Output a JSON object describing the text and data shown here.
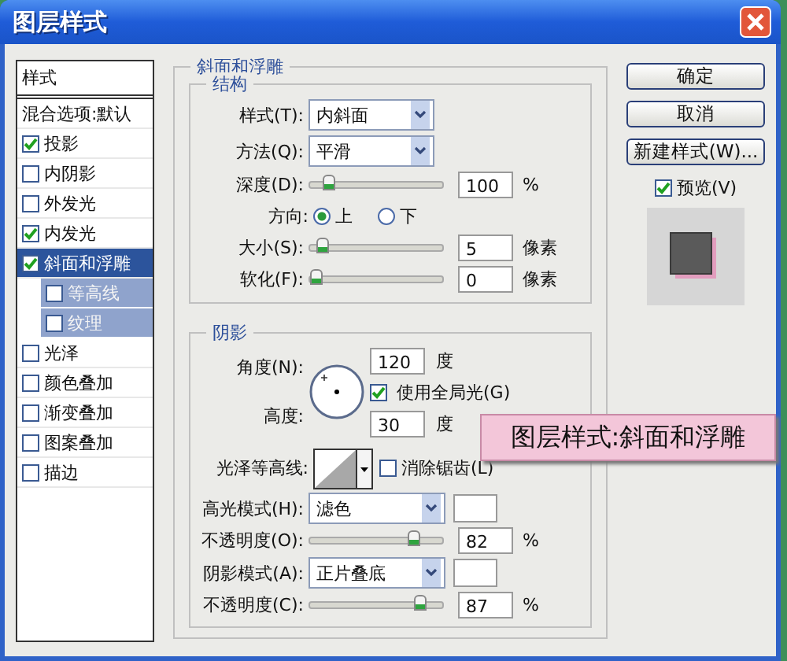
{
  "window": {
    "title": "图层样式"
  },
  "styles_list": {
    "header": "样式",
    "items": [
      {
        "kind": "option",
        "label": "混合选项:默认",
        "selected": false
      },
      {
        "kind": "effect",
        "label": "投影",
        "checked": true,
        "selected": false
      },
      {
        "kind": "effect",
        "label": "内阴影",
        "checked": false,
        "selected": false
      },
      {
        "kind": "effect",
        "label": "外发光",
        "checked": false,
        "selected": false
      },
      {
        "kind": "effect",
        "label": "内发光",
        "checked": true,
        "selected": false
      },
      {
        "kind": "effect",
        "label": "斜面和浮雕",
        "checked": true,
        "selected": true,
        "children": [
          {
            "kind": "effect",
            "label": "等高线",
            "checked": false,
            "selected": false
          },
          {
            "kind": "effect",
            "label": "纹理",
            "checked": false,
            "selected": false
          }
        ]
      },
      {
        "kind": "effect",
        "label": "光泽",
        "checked": false,
        "selected": false
      },
      {
        "kind": "effect",
        "label": "颜色叠加",
        "checked": false,
        "selected": false
      },
      {
        "kind": "effect",
        "label": "渐变叠加",
        "checked": false,
        "selected": false
      },
      {
        "kind": "effect",
        "label": "图案叠加",
        "checked": false,
        "selected": false
      },
      {
        "kind": "effect",
        "label": "描边",
        "checked": false,
        "selected": false
      }
    ]
  },
  "panel": {
    "title": "斜面和浮雕",
    "structure": {
      "title": "结构",
      "rows": [
        {
          "kind": "dropdown",
          "label": "样式(T):",
          "value": "内斜面"
        },
        {
          "kind": "dropdown",
          "label": "方法(Q):",
          "value": "平滑"
        },
        {
          "kind": "slider",
          "label": "深度(D):",
          "level": 0.1,
          "value": "100",
          "unit": "%"
        },
        {
          "kind": "radio",
          "label": "方向:",
          "options": [
            {
              "label": "上",
              "selected": true
            },
            {
              "label": "下",
              "selected": false
            }
          ]
        },
        {
          "kind": "slider",
          "label": "大小(S):",
          "level": 0.05,
          "value": "5",
          "unit": "像素"
        },
        {
          "kind": "slider",
          "label": "软化(F):",
          "level": 0,
          "value": "0",
          "unit": "像素"
        }
      ]
    },
    "shading": {
      "title": "阴影",
      "angle_label": "角度(N):",
      "angle": "120",
      "angle_unit": "度",
      "global_light": {
        "label": "使用全局光(G)",
        "checked": true
      },
      "altitude_label": "高度:",
      "altitude": "30",
      "altitude_unit": "度",
      "gloss_label": "光泽等高线:",
      "anti_alias": {
        "label": "消除锯齿(L)",
        "checked": false
      },
      "rows": [
        {
          "kind": "blend",
          "label": "高光模式(H):",
          "value": "滤色"
        },
        {
          "kind": "slider",
          "label": "不透明度(O):",
          "level": 0.82,
          "value": "82",
          "unit": "%"
        },
        {
          "kind": "blend",
          "label": "阴影模式(A):",
          "value": "正片叠底"
        },
        {
          "kind": "slider",
          "label": "不透明度(C):",
          "level": 0.87,
          "value": "87",
          "unit": "%"
        }
      ]
    }
  },
  "buttons": [
    "确定",
    "取消",
    "新建样式(W)..."
  ],
  "preview": {
    "label": "预览(V)",
    "checked": true
  },
  "caption": "图层样式:斜面和浮雕"
}
